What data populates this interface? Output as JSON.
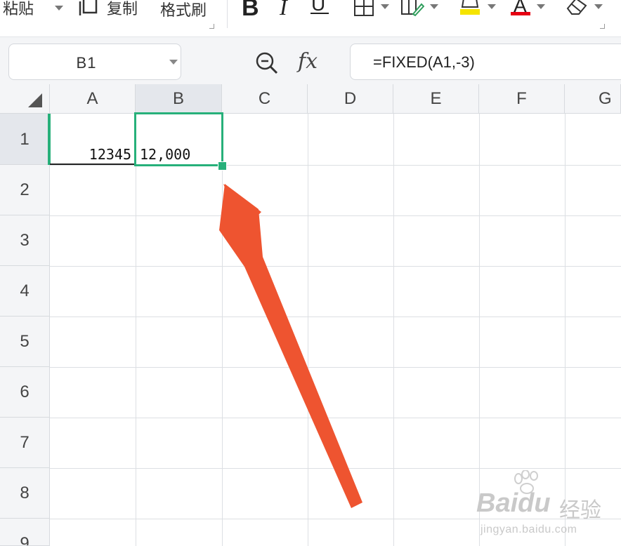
{
  "toolbar": {
    "paste_label": "粘贴",
    "copy_label": "复制",
    "format_painter_label": "格式刷",
    "bold_label": "B",
    "italic_label": "I",
    "underline_label": "U",
    "font_color_label": "A",
    "highlight_color": "#f5e400",
    "font_color": "#e60012"
  },
  "formula_bar": {
    "name_box": "B1",
    "fx_label": "fx",
    "formula": "=FIXED(A1,-3)"
  },
  "columns": [
    "A",
    "B",
    "C",
    "D",
    "E",
    "F",
    "G"
  ],
  "rows": [
    "1",
    "2",
    "3",
    "4",
    "5",
    "6",
    "7",
    "8",
    "9"
  ],
  "selected_cell": "B1",
  "cells": {
    "A1": "12345",
    "B1": "12,000"
  },
  "colors": {
    "selection": "#27b07a",
    "arrow": "#ee5430"
  },
  "watermark": {
    "brand": "Baidu",
    "brand_cn": "经验",
    "url": "jingyan.baidu.com"
  }
}
